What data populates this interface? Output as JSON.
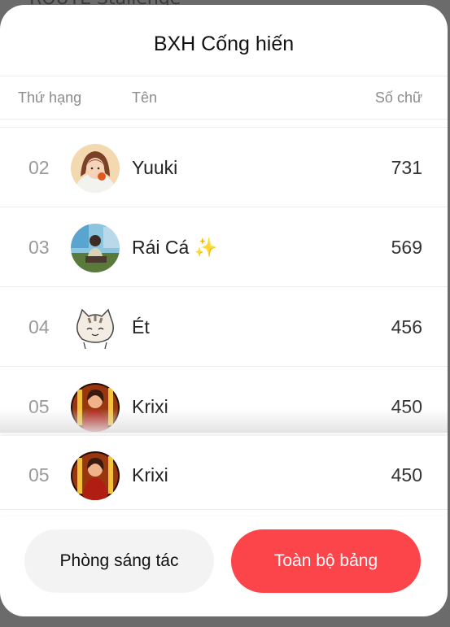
{
  "background_text": "ROUTE Stallenge",
  "title": "BXH Cống hiến",
  "headers": {
    "rank": "Thứ hạng",
    "name": "Tên",
    "count": "Số chữ"
  },
  "rows": [
    {
      "rank": "02",
      "name": "Yuuki",
      "count": "731",
      "avatar": "girl-avatar-icon"
    },
    {
      "rank": "03",
      "name": "Rái Cá ✨",
      "count": "569",
      "avatar": "person-avatar-icon"
    },
    {
      "rank": "04",
      "name": "Ét",
      "count": "456",
      "avatar": "cat-avatar-icon"
    },
    {
      "rank": "05",
      "name": "Krixi",
      "count": "450",
      "avatar": "warrior-avatar-icon"
    }
  ],
  "current_user": {
    "rank": "05",
    "name": "Krixi",
    "count": "450",
    "avatar": "warrior-avatar-icon"
  },
  "buttons": {
    "studio": "Phòng sáng tác",
    "full_board": "Toàn bộ bảng"
  },
  "colors": {
    "accent": "#fc444b",
    "secondary_button": "#f3f3f3"
  }
}
